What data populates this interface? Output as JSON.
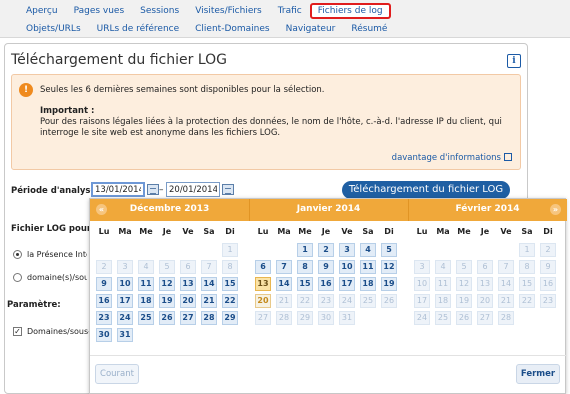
{
  "nav": {
    "row1": [
      "Aperçu",
      "Pages vues",
      "Sessions",
      "Visites/Fichiers",
      "Trafic",
      "Fichiers de log"
    ],
    "row2": [
      "Objets/URLs",
      "URLs de référence",
      "Client-Domaines",
      "Navigateur",
      "Résumé"
    ],
    "active": "Fichiers de log"
  },
  "panel": {
    "title": "Téléchargement du fichier LOG",
    "info_icon": "i"
  },
  "notice": {
    "icon": "!",
    "line1": "Seules les 6 dernières semaines sont disponibles pour la sélection.",
    "important_label": "Important :",
    "body": "Pour des raisons légales liées à la protection des données, le nom de l'hôte, c.-à-d. l'adresse IP du client, qui interroge le site web est anonyme dans les fichiers LOG.",
    "more_link": "davantage d'informations"
  },
  "period": {
    "label": "Période d'analyse:",
    "from": "13/01/2014",
    "to": "20/01/2014",
    "separator": "–",
    "download_button": "Téléchargement du fichier LOG"
  },
  "options": {
    "log_label": "Fichier LOG pour:",
    "radio1": "la Présence Internet",
    "radio2": "domaine(s)/sous-domaine(s)",
    "param_label": "Paramètre:",
    "checkbox": "Domaines/sous-domaines",
    "checkbox_mark": "✓"
  },
  "datepicker": {
    "prev_icon": "«",
    "next_icon": "»",
    "weekdays": [
      "Lu",
      "Ma",
      "Me",
      "Je",
      "Ve",
      "Sa",
      "Di"
    ],
    "months": [
      {
        "name": "Décembre 2013",
        "rows": [
          [
            [
              "",
              ""
            ],
            [
              "",
              ""
            ],
            [
              "",
              ""
            ],
            [
              "",
              ""
            ],
            [
              "",
              ""
            ],
            [
              "",
              ""
            ],
            [
              "1",
              "faded"
            ]
          ],
          [
            [
              "2",
              "faded"
            ],
            [
              "3",
              "faded"
            ],
            [
              "4",
              "faded"
            ],
            [
              "5",
              "faded"
            ],
            [
              "6",
              "faded"
            ],
            [
              "7",
              "faded"
            ],
            [
              "8",
              "faded"
            ]
          ],
          [
            [
              "9",
              ""
            ],
            [
              "10",
              ""
            ],
            [
              "11",
              ""
            ],
            [
              "12",
              ""
            ],
            [
              "13",
              ""
            ],
            [
              "14",
              ""
            ],
            [
              "15",
              ""
            ]
          ],
          [
            [
              "16",
              ""
            ],
            [
              "17",
              ""
            ],
            [
              "18",
              ""
            ],
            [
              "19",
              ""
            ],
            [
              "20",
              ""
            ],
            [
              "21",
              ""
            ],
            [
              "22",
              ""
            ]
          ],
          [
            [
              "23",
              ""
            ],
            [
              "24",
              ""
            ],
            [
              "25",
              ""
            ],
            [
              "26",
              ""
            ],
            [
              "27",
              ""
            ],
            [
              "28",
              ""
            ],
            [
              "29",
              ""
            ]
          ],
          [
            [
              "30",
              ""
            ],
            [
              "31",
              ""
            ],
            [
              "",
              ""
            ],
            [
              "",
              ""
            ],
            [
              "",
              ""
            ],
            [
              "",
              ""
            ],
            [
              "",
              ""
            ]
          ]
        ]
      },
      {
        "name": "Janvier 2014",
        "rows": [
          [
            [
              "",
              ""
            ],
            [
              "",
              ""
            ],
            [
              "1",
              ""
            ],
            [
              "2",
              ""
            ],
            [
              "3",
              ""
            ],
            [
              "4",
              ""
            ],
            [
              "5",
              ""
            ]
          ],
          [
            [
              "6",
              ""
            ],
            [
              "7",
              ""
            ],
            [
              "8",
              ""
            ],
            [
              "9",
              ""
            ],
            [
              "10",
              ""
            ],
            [
              "11",
              ""
            ],
            [
              "12",
              ""
            ]
          ],
          [
            [
              "13",
              "sel"
            ],
            [
              "14",
              ""
            ],
            [
              "15",
              ""
            ],
            [
              "16",
              ""
            ],
            [
              "17",
              ""
            ],
            [
              "18",
              ""
            ],
            [
              "19",
              ""
            ]
          ],
          [
            [
              "20",
              "today"
            ],
            [
              "21",
              "faded"
            ],
            [
              "22",
              "faded"
            ],
            [
              "23",
              "faded"
            ],
            [
              "24",
              "faded"
            ],
            [
              "25",
              "faded"
            ],
            [
              "26",
              "faded"
            ]
          ],
          [
            [
              "27",
              "faded"
            ],
            [
              "28",
              "faded"
            ],
            [
              "29",
              "faded"
            ],
            [
              "30",
              "faded"
            ],
            [
              "31",
              "faded"
            ],
            [
              "",
              ""
            ],
            [
              "",
              ""
            ]
          ],
          [
            [
              "",
              ""
            ],
            [
              "",
              ""
            ],
            [
              "",
              ""
            ],
            [
              "",
              ""
            ],
            [
              "",
              ""
            ],
            [
              "",
              ""
            ],
            [
              "",
              ""
            ]
          ]
        ]
      },
      {
        "name": "Février 2014",
        "rows": [
          [
            [
              "",
              ""
            ],
            [
              "",
              ""
            ],
            [
              "",
              ""
            ],
            [
              "",
              ""
            ],
            [
              "",
              ""
            ],
            [
              "1",
              "faded"
            ],
            [
              "2",
              "faded"
            ]
          ],
          [
            [
              "3",
              "faded"
            ],
            [
              "4",
              "faded"
            ],
            [
              "5",
              "faded"
            ],
            [
              "6",
              "faded"
            ],
            [
              "7",
              "faded"
            ],
            [
              "8",
              "faded"
            ],
            [
              "9",
              "faded"
            ]
          ],
          [
            [
              "10",
              "faded"
            ],
            [
              "11",
              "faded"
            ],
            [
              "12",
              "faded"
            ],
            [
              "13",
              "faded"
            ],
            [
              "14",
              "faded"
            ],
            [
              "15",
              "faded"
            ],
            [
              "16",
              "faded"
            ]
          ],
          [
            [
              "17",
              "faded"
            ],
            [
              "18",
              "faded"
            ],
            [
              "19",
              "faded"
            ],
            [
              "20",
              "faded"
            ],
            [
              "21",
              "faded"
            ],
            [
              "22",
              "faded"
            ],
            [
              "23",
              "faded"
            ]
          ],
          [
            [
              "24",
              "faded"
            ],
            [
              "25",
              "faded"
            ],
            [
              "26",
              "faded"
            ],
            [
              "27",
              "faded"
            ],
            [
              "28",
              "faded"
            ],
            [
              "",
              ""
            ],
            [
              "",
              ""
            ]
          ],
          [
            [
              "",
              ""
            ],
            [
              "",
              ""
            ],
            [
              "",
              ""
            ],
            [
              "",
              ""
            ],
            [
              "",
              ""
            ],
            [
              "",
              ""
            ],
            [
              "",
              ""
            ]
          ]
        ]
      }
    ],
    "current_button": "Courant",
    "close_button": "Fermer"
  }
}
